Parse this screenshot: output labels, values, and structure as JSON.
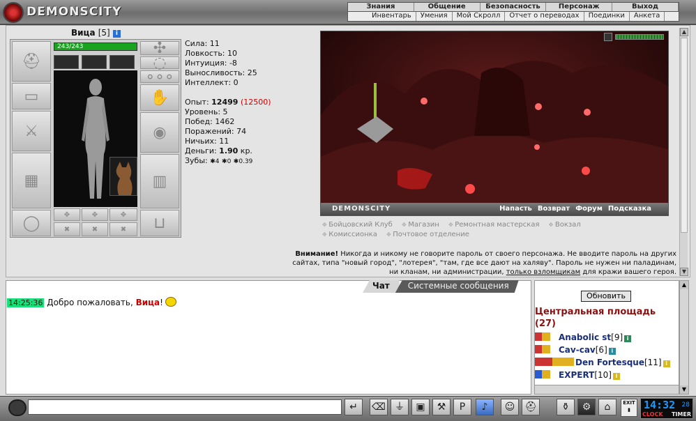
{
  "brand": "DEMONSCITY",
  "menu": {
    "top": [
      "Знания",
      "Общение",
      "Безопасность",
      "Персонаж",
      "Выход"
    ],
    "sub": [
      "Инвентарь",
      "Умения",
      "Мой Скролл",
      "Отчет о переводах",
      "Поединки",
      "Анкета"
    ]
  },
  "character": {
    "name": "Вица",
    "level": "[5]",
    "hp": "243/243",
    "stats": {
      "strength": "Сила: 11",
      "agility": "Ловкость: 10",
      "intuition": "Интуиция: -8",
      "endurance": "Выносливость: 25",
      "intellect": "Интеллект: 0"
    },
    "exp_label": "Опыт: ",
    "exp": "12499",
    "exp_next": "(12500)",
    "level_line": "Уровень: 5",
    "wins": "Побед: 1462",
    "losses": "Поражений: 74",
    "draws": "Ничьих: 11",
    "money_label": "Деньги: ",
    "money": "1.90",
    "money_unit": " кр.",
    "teeth_label": "Зубы: ",
    "teeth": [
      "4",
      "0",
      "0.39"
    ]
  },
  "scene": {
    "brand": "DEMONSCITY",
    "links": [
      "Напасть",
      "Возврат",
      "Форум",
      "Подсказка"
    ]
  },
  "locations": [
    "Бойцовский Клуб",
    "Магазин",
    "Ремонтная мастерская",
    "Вокзал",
    "Комиссионка",
    "Почтовое отделение"
  ],
  "warning": {
    "bold": "Внимание!",
    "text": " Никогда и никому не говорите пароль от своего персонажа. Не вводите пароль на других сайтах, типа \"новый город\", \"лотерея\", \"там, где все дают на халяву\". Пароль не нужен ни паладинам, ни кланам, ни администрации, ",
    "underlined": "только взломщикам",
    "tail": " для кражи вашего героя."
  },
  "chat": {
    "tab_chat": "Чат",
    "tab_system": "Системные сообщения",
    "message": {
      "time": "14:25:36",
      "text": " Добро пожаловать, ",
      "nick": "Вица",
      "end": "!"
    }
  },
  "users": {
    "refresh": "Обновить",
    "place": "Центральная площадь",
    "count": "(27)",
    "list": [
      {
        "name": "Anabolic st",
        "level": "[9]"
      },
      {
        "name": "Cav-cav",
        "level": "[6]"
      },
      {
        "name": "Den Fortesque",
        "level": "[11]"
      },
      {
        "name": "EXPERT",
        "level": "[10]"
      }
    ]
  },
  "bottom": {
    "chat_input": "",
    "exit_label": "EXIT",
    "clock_time": "14:32",
    "clock_sec": "28",
    "clock_label": "CLOCK",
    "timer_label": "TIMER"
  }
}
